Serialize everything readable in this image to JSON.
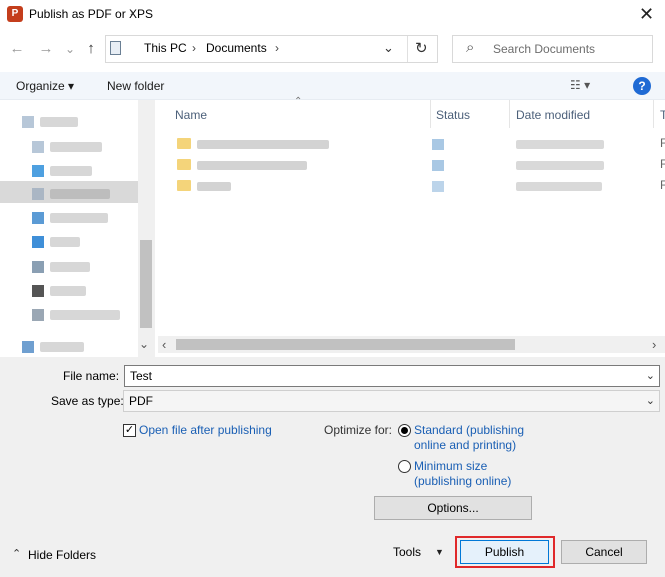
{
  "window": {
    "title": "Publish as PDF or XPS",
    "app_icon_letter": "P",
    "close_glyph": "✕"
  },
  "nav": {
    "back_glyph": "←",
    "forward_glyph": "→",
    "recent_glyph": "⌄",
    "up_glyph": "↑"
  },
  "address": {
    "segments": [
      "This PC",
      "Documents"
    ],
    "separator": "›",
    "dropdown_glyph": "⌄",
    "refresh_glyph": "↻"
  },
  "search": {
    "placeholder": "Search Documents",
    "icon_glyph": "⌕"
  },
  "toolbar": {
    "organize_label": "Organize ▾",
    "new_folder_label": "New folder",
    "view_glyph": "☷ ▾",
    "help_glyph": "?"
  },
  "columns": {
    "name": "Name",
    "status": "Status",
    "date_modified": "Date modified",
    "type_partial": "T",
    "sort_glyph": "⌃"
  },
  "files": [
    {
      "type_partial": "F"
    },
    {
      "type_partial": "F"
    },
    {
      "type_partial": "F"
    }
  ],
  "scroll": {
    "down_glyph": "⌄",
    "left_glyph": "‹",
    "right_glyph": "›"
  },
  "form": {
    "file_name_label": "File name:",
    "file_name_value": "Test",
    "save_as_type_label": "Save as type:",
    "save_as_type_value": "PDF",
    "dropdown_glyph": "⌄",
    "open_after_label": "Open file after publishing",
    "open_after_checked_glyph": "✓",
    "optimize_label": "Optimize for:",
    "standard_line1": "Standard (publishing",
    "standard_line2": "online and printing)",
    "minimum_line1": "Minimum size",
    "minimum_line2": "(publishing online)",
    "options_label": "Options...",
    "tools_label": "Tools",
    "tools_arrow": "▼",
    "publish_label": "Publish",
    "cancel_label": "Cancel",
    "hide_folders_label": "Hide Folders",
    "hide_folders_glyph": "⌃"
  }
}
